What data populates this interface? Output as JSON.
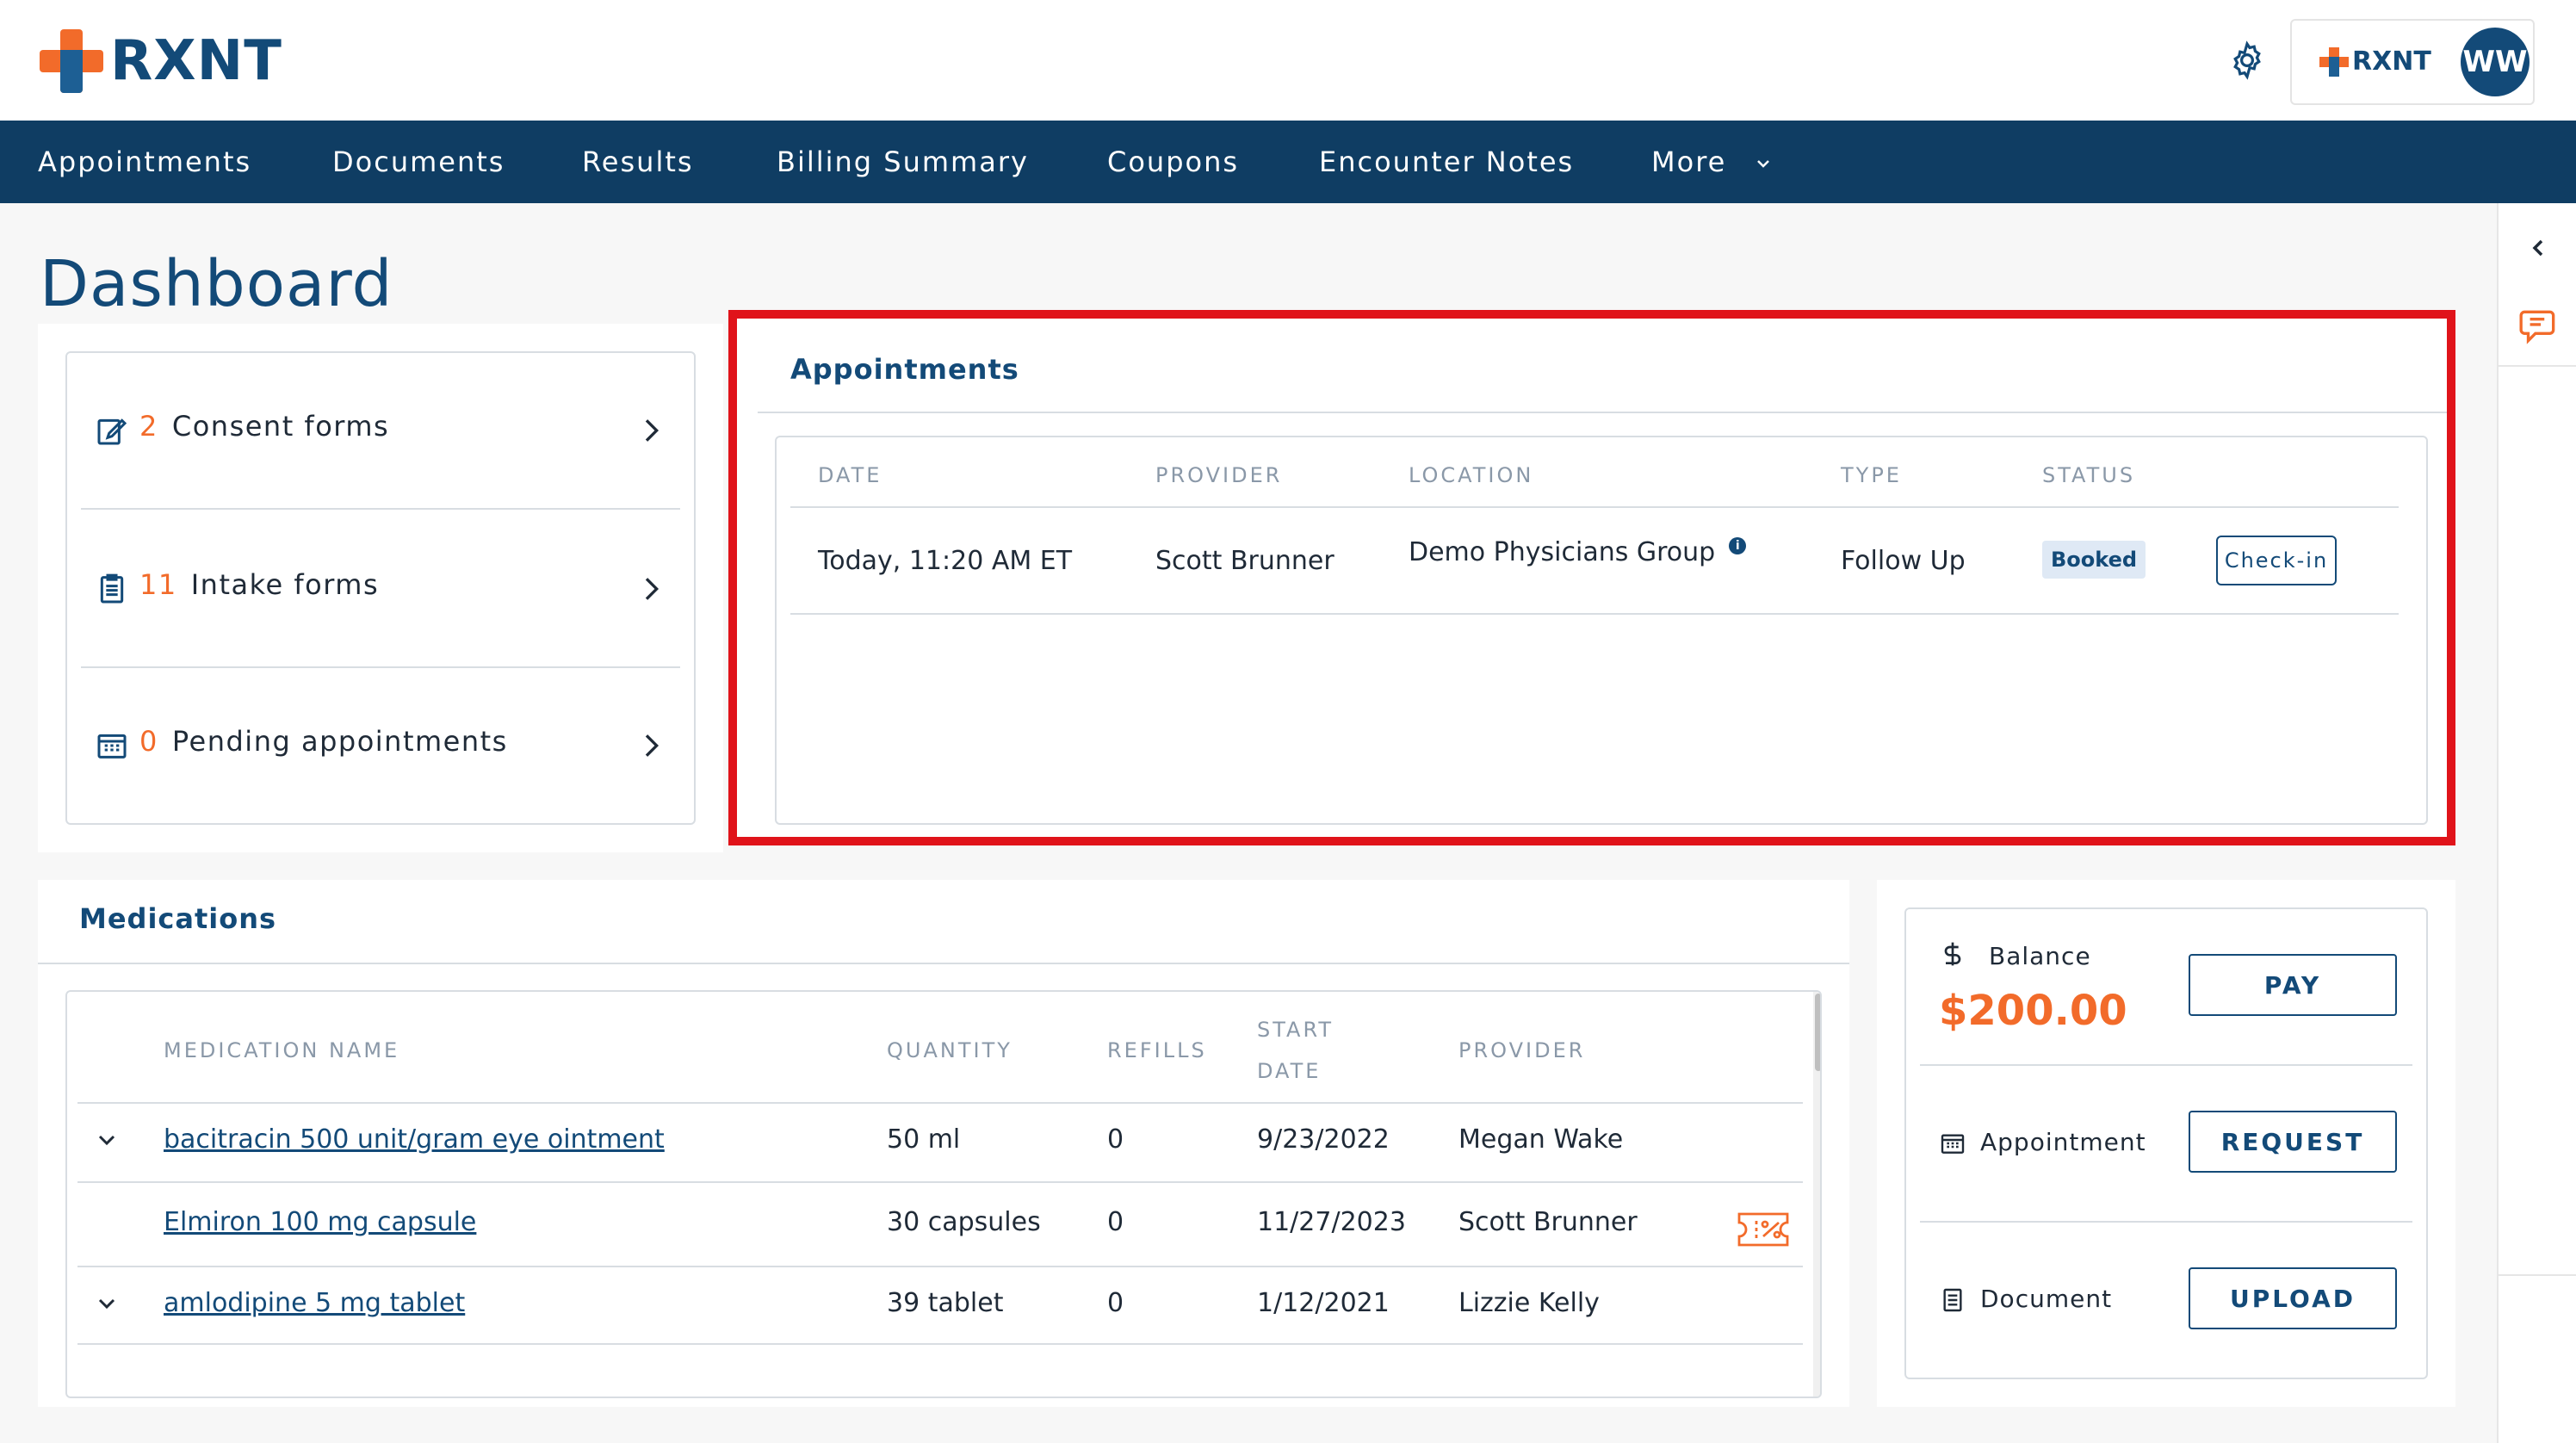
{
  "brand": {
    "name": "RXNT",
    "account_initials": "WW",
    "accent": "#f26b2a",
    "primary": "#134a78"
  },
  "nav": {
    "items": [
      "Appointments",
      "Documents",
      "Results",
      "Billing Summary",
      "Coupons",
      "Encounter Notes",
      "More"
    ]
  },
  "page": {
    "title": "Dashboard"
  },
  "forms": [
    {
      "count": "2",
      "label": "Consent forms",
      "icon": "edit-form-icon"
    },
    {
      "count": "11",
      "label": "Intake forms",
      "icon": "clipboard-icon"
    },
    {
      "count": "0",
      "label": "Pending appointments",
      "icon": "calendar-icon"
    }
  ],
  "appointments": {
    "title": "Appointments",
    "columns": [
      "DATE",
      "PROVIDER",
      "LOCATION",
      "TYPE",
      "STATUS"
    ],
    "rows": [
      {
        "date": "Today, 11:20 AM ET",
        "provider": "Scott Brunner",
        "location": "Demo Physicians Group",
        "type": "Follow Up",
        "status": "Booked",
        "action": "Check-in"
      }
    ]
  },
  "medications": {
    "title": "Medications",
    "columns": [
      "MEDICATION NAME",
      "QUANTITY",
      "REFILLS",
      "START",
      "DATE",
      "PROVIDER"
    ],
    "rows": [
      {
        "name": "bacitracin 500 unit/gram eye ointment",
        "quantity": "50 ml",
        "refills": "0",
        "start_date": "9/23/2022",
        "provider": "Megan Wake"
      },
      {
        "name": "Elmiron 100 mg capsule",
        "quantity": "30 capsules",
        "refills": "0",
        "start_date": "11/27/2023",
        "provider": "Scott Brunner"
      },
      {
        "name": "amlodipine 5 mg tablet",
        "quantity": "39 tablet",
        "refills": "0",
        "start_date": "1/12/2021",
        "provider": "Lizzie Kelly"
      }
    ]
  },
  "billing": {
    "balance_label": "Balance",
    "balance_amount": "$200.00",
    "pay_label": "PAY",
    "appointment_label": "Appointment",
    "request_label": "REQUEST",
    "document_label": "Document",
    "upload_label": "UPLOAD"
  }
}
